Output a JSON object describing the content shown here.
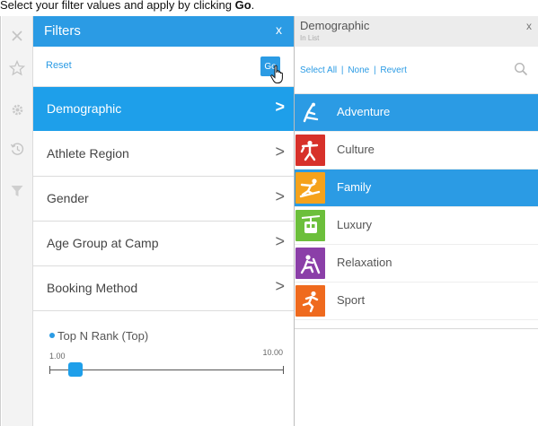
{
  "instruction": {
    "text_before": "Select your filter values and apply by clicking ",
    "emphasis": "Go",
    "text_after": "."
  },
  "rail": {
    "icons": [
      "close-icon",
      "star-icon",
      "gear-icon",
      "history-icon",
      "funnel-icon"
    ]
  },
  "filters": {
    "title": "Filters",
    "close_label": "x",
    "reset_label": "Reset",
    "go_label": "Go",
    "items": [
      {
        "label": "Demographic",
        "active": true
      },
      {
        "label": "Athlete Region",
        "active": false
      },
      {
        "label": "Gender",
        "active": false
      },
      {
        "label": "Age Group at Camp",
        "active": false
      },
      {
        "label": "Booking Method",
        "active": false
      }
    ],
    "chevron": ">",
    "slider": {
      "title": "Top N Rank (Top)",
      "min_label": "1.00",
      "max_label": "10.00",
      "min": 1,
      "max": 10,
      "value": 2
    }
  },
  "demographic": {
    "title": "Demographic",
    "subtitle": "In List",
    "close_label": "x",
    "select_all_label": "Select All",
    "none_label": "None",
    "revert_label": "Revert",
    "separator": "|",
    "options": [
      {
        "label": "Adventure",
        "selected": true,
        "icon": "adventure-icon",
        "color": "#2b9be4"
      },
      {
        "label": "Culture",
        "selected": false,
        "icon": "culture-icon",
        "color": "#d7312a"
      },
      {
        "label": "Family",
        "selected": true,
        "icon": "family-icon",
        "color": "#f5a21b"
      },
      {
        "label": "Luxury",
        "selected": false,
        "icon": "luxury-icon",
        "color": "#6cbf3b"
      },
      {
        "label": "Relaxation",
        "selected": false,
        "icon": "relaxation-icon",
        "color": "#8b3fa8"
      },
      {
        "label": "Sport",
        "selected": false,
        "icon": "sport-icon",
        "color": "#ef6a1e"
      }
    ]
  },
  "colors": {
    "accent": "#2b9be4",
    "active_row": "#1e9fea",
    "rail_bg": "#f3f3f3"
  }
}
